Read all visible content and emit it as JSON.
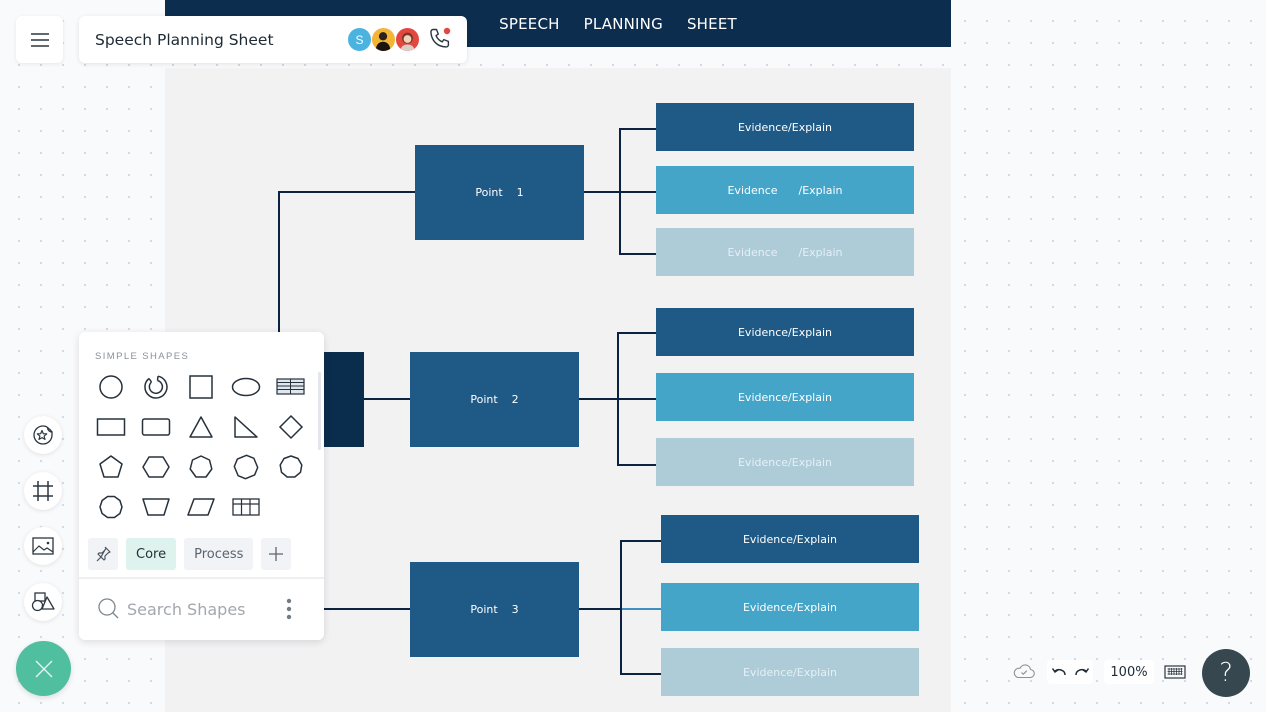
{
  "app": {
    "document_title": "Speech Planning Sheet",
    "menu_icon": "hamburger-menu-icon"
  },
  "collaborators": [
    {
      "initial": "S",
      "color": "#4bb3e0",
      "type": "initial"
    },
    {
      "initial": "",
      "color": "#f3b536",
      "type": "photo"
    },
    {
      "initial": "",
      "color": "#e4473f",
      "type": "photo"
    }
  ],
  "call": {
    "icon": "phone-icon",
    "indicator_color": "#e4473f"
  },
  "canvas": {
    "header_words": [
      "SPEECH",
      "PLANNING",
      "SHEET"
    ],
    "points": [
      {
        "label": "Point    1",
        "evidence": [
          "Evidence/Explain",
          "Evidence      /Explain",
          "Evidence      /Explain"
        ]
      },
      {
        "label": "Point    2",
        "evidence": [
          "Evidence/Explain",
          "Evidence/Explain",
          "Evidence/Explain"
        ]
      },
      {
        "label": "Point    3",
        "evidence": [
          "Evidence/Explain",
          "Evidence/Explain",
          "Evidence/Explain"
        ]
      }
    ],
    "colors": {
      "header": "#0d2d4f",
      "root": "#0b2d4d",
      "point": "#1f5a86",
      "evidence_dark": "#1f5a86",
      "evidence_mid": "#45a5c9",
      "evidence_light": "#aecbd8",
      "connector": "#0b2340"
    }
  },
  "shapes_panel": {
    "heading": "SIMPLE SHAPES",
    "shapes": [
      "circle",
      "donut",
      "square",
      "ellipse",
      "table-lines",
      "rectangle",
      "rounded-rectangle",
      "triangle",
      "right-triangle",
      "diamond",
      "pentagon",
      "hexagon",
      "heptagon",
      "octagon",
      "nonagon",
      "decagon",
      "trapezoid",
      "parallelogram",
      "table-grid"
    ],
    "tabs": [
      {
        "label": "",
        "icon": "pin-icon"
      },
      {
        "label": "Core",
        "active": true
      },
      {
        "label": "Process"
      },
      {
        "label": "",
        "icon": "plus-icon"
      }
    ],
    "search_placeholder": "Search Shapes"
  },
  "left_tools": [
    {
      "name": "sticker-tool",
      "icon": "star-sticker-icon"
    },
    {
      "name": "frame-tool",
      "icon": "frame-icon"
    },
    {
      "name": "image-tool",
      "icon": "image-icon"
    },
    {
      "name": "shapes-tool",
      "icon": "shapes-icon"
    }
  ],
  "bottom_bar": {
    "zoom_level": "100%",
    "help_label": "?"
  }
}
